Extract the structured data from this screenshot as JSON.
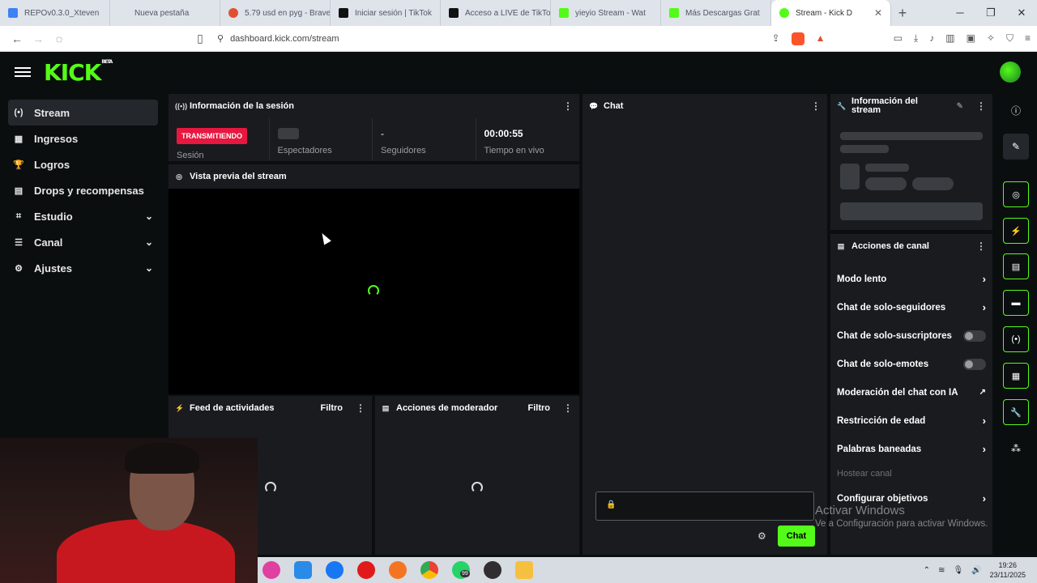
{
  "browser": {
    "tabs": [
      {
        "title": "REPOv0.3.0_Xteven",
        "color": "#3b82f6"
      },
      {
        "title": "Nueva pestaña",
        "color": "#dfe3ea"
      },
      {
        "title": "5.79 usd en pyg - Brave",
        "color": "#e05030"
      },
      {
        "title": "Iniciar sesión | TikTok",
        "color": "#111111"
      },
      {
        "title": "Acceso a LIVE de TikTok",
        "color": "#111111"
      },
      {
        "title": "yieyio Stream - Wat",
        "color": "#53fc18"
      },
      {
        "title": "Más Descargas Grat",
        "color": "#53fc18"
      },
      {
        "title": "Stream - Kick D",
        "color": "#53fc18"
      }
    ],
    "url": "dashboard.kick.com/stream"
  },
  "header": {
    "logo": "KICK",
    "beta": "BETA"
  },
  "sidebar": {
    "items": [
      {
        "label": "Stream",
        "icon": "(•)"
      },
      {
        "label": "Ingresos",
        "icon": "▦"
      },
      {
        "label": "Logros",
        "icon": "🏆"
      },
      {
        "label": "Drops y recompensas",
        "icon": "▤"
      },
      {
        "label": "Estudio",
        "icon": "⌗"
      },
      {
        "label": "Canal",
        "icon": "☰"
      },
      {
        "label": "Ajustes",
        "icon": "⚙"
      }
    ]
  },
  "session": {
    "title": "Información de la sesión",
    "status": "TRANSMITIENDO",
    "status_sub": "Sesión",
    "followers_value": "-",
    "viewers_label": "Espectadores",
    "followers_label": "Seguidores",
    "time_value": "00:00:55",
    "time_label": "Tiempo en vivo"
  },
  "preview": {
    "title": "Vista previa del stream"
  },
  "activity": {
    "title": "Feed de actividades",
    "filter": "Filtro"
  },
  "moderator": {
    "title": "Acciones de moderador",
    "filter": "Filtro"
  },
  "chat": {
    "title": "Chat",
    "send": "Chat"
  },
  "stream_info": {
    "title": "Información del stream"
  },
  "channel_actions": {
    "title": "Acciones de canal",
    "rows": [
      {
        "label": "Modo lento",
        "kind": "chevron"
      },
      {
        "label": "Chat de solo-seguidores",
        "kind": "chevron"
      },
      {
        "label": "Chat de solo-suscriptores",
        "kind": "toggle"
      },
      {
        "label": "Chat de solo-emotes",
        "kind": "toggle"
      },
      {
        "label": "Moderación del chat con IA",
        "kind": "external"
      },
      {
        "label": "Restricción de edad",
        "kind": "chevron"
      },
      {
        "label": "Palabras baneadas",
        "kind": "chevron"
      },
      {
        "label": "Hostear canal",
        "kind": "muted"
      },
      {
        "label": "Configurar objetivos",
        "kind": "chevron"
      }
    ]
  },
  "windows": {
    "watermark_title": "Activar Windows",
    "watermark_sub": "Ve a Configuración para activar Windows.",
    "time": "19:26",
    "date": "23/11/2025",
    "badge": "99"
  },
  "colors": {
    "accent": "#53fc18",
    "live": "#e7173f",
    "panel": "#191b1f"
  }
}
